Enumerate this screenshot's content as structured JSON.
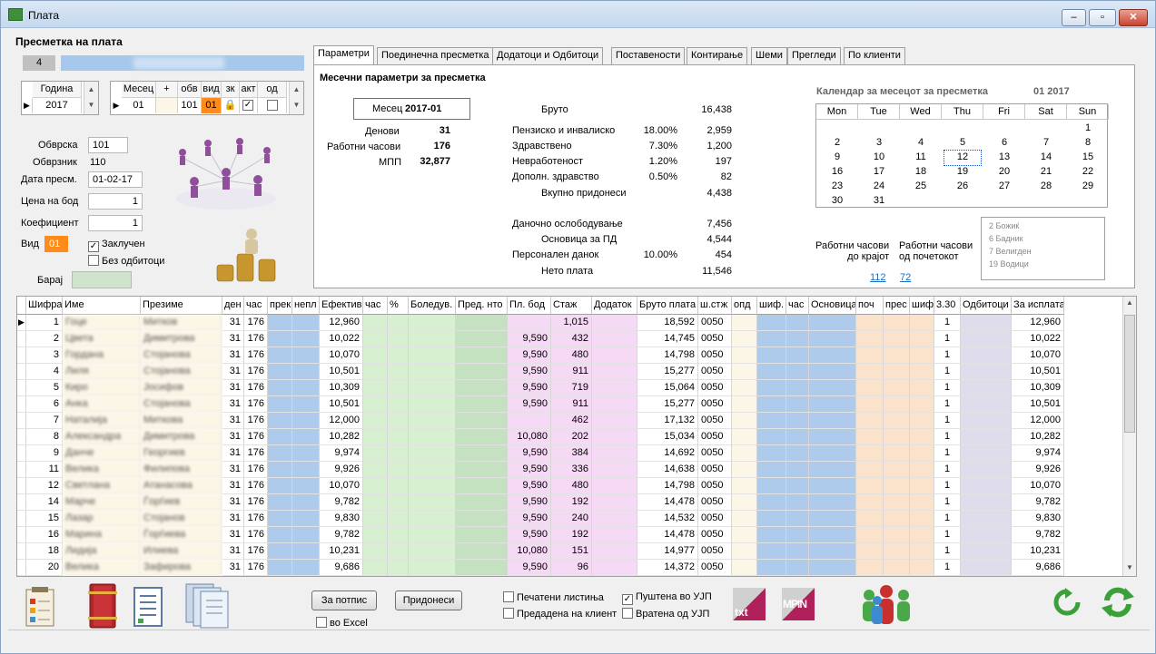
{
  "window": {
    "title": "Плата"
  },
  "left": {
    "heading": "Пресметка на плата",
    "progress_value": "4",
    "year_grid": {
      "header": "Година",
      "value": "2017"
    },
    "month_grid": {
      "headers": [
        "Месец",
        "+",
        "обв",
        "вид",
        "зк",
        "акт",
        "од"
      ],
      "values": [
        "01",
        "",
        "101",
        "01",
        "",
        "",
        ""
      ]
    },
    "obvrska_label": "Обврска",
    "obvrska_value": "101",
    "obvrznik_label": "Обврзник",
    "obvrznik_value": "110",
    "datum_label": "Дата пресм.",
    "datum_value": "01-02-17",
    "cena_label": "Цена на бод",
    "cena_value": "1",
    "koef_label": "Коефициент",
    "koef_value": "1",
    "vid_label": "Вид",
    "vid_value": "01",
    "zaklucen_label": "Заклучен",
    "zaklucen_checked": true,
    "bez_odbitoci_label": "Без одбитоци",
    "bez_odbitoci_checked": false,
    "baraj_label": "Барај"
  },
  "tabs": [
    "Параметри",
    "Поединечна пресметка",
    "Додатоци и Одбитоци",
    "Поставености",
    "Контирање",
    "Шеми",
    "Прегледи",
    "По клиенти"
  ],
  "params": {
    "heading": "Месечни параметри за пресметка",
    "mesec_label": "Месец",
    "mesec_value": "2017-01",
    "denovi_label": "Денови",
    "denovi_value": "31",
    "rab_casovi_label": "Работни часови",
    "rab_casovi_value": "176",
    "mpp_label": "МПП",
    "mpp_value": "32,877",
    "bruto_label": "Бруто",
    "bruto_value": "16,438",
    "rows": [
      {
        "label": "Пензиско и инвалиско",
        "pct": "18.00%",
        "value": "2,959"
      },
      {
        "label": "Здравствено",
        "pct": "7.30%",
        "value": "1,200"
      },
      {
        "label": "Невработеност",
        "pct": "1.20%",
        "value": "197"
      },
      {
        "label": "Дополн. здравство",
        "pct": "0.50%",
        "value": "82"
      }
    ],
    "vkupno_label": "Вкупно придонеси",
    "vkupno_value": "4,438",
    "danocno_label": "Даночно ослободување",
    "danocno_value": "7,456",
    "osnovica_label": "Основица за ПД",
    "osnovica_value": "4,544",
    "personalen_label": "Персонален данок",
    "personalen_pct": "10.00%",
    "personalen_value": "454",
    "neto_label": "Нето плата",
    "neto_value": "11,546"
  },
  "calendar": {
    "title": "Календар за месецот за пресметка",
    "month_year": "01  2017",
    "days": [
      "Mon",
      "Tue",
      "Wed",
      "Thu",
      "Fri",
      "Sat",
      "Sun"
    ],
    "weeks": [
      [
        "",
        "",
        "",
        "",
        "",
        "",
        "1"
      ],
      [
        "2",
        "3",
        "4",
        "5",
        "6",
        "7",
        "8"
      ],
      [
        "9",
        "10",
        "11",
        "12",
        "13",
        "14",
        "15"
      ],
      [
        "16",
        "17",
        "18",
        "19",
        "20",
        "21",
        "22"
      ],
      [
        "23",
        "24",
        "25",
        "26",
        "27",
        "28",
        "29"
      ],
      [
        "30",
        "31",
        "",
        "",
        "",
        "",
        ""
      ]
    ],
    "today": "12",
    "rab_do_kraj_label1": "Работни часови",
    "rab_do_kraj_label2": "до крајот",
    "rab_do_kraj_value": "112",
    "rab_od_poc_label1": "Работни часови",
    "rab_od_poc_label2": "од почетокот",
    "rab_od_poc_value": "72",
    "holidays": [
      "2   Божиќ",
      "6   Бадник",
      "7   Велигден",
      "19  Водици"
    ]
  },
  "grid": {
    "headers": [
      "Шифра",
      "Име",
      "Презиме",
      "ден",
      "час",
      "прек",
      "непл",
      "Ефектив",
      "час",
      "%",
      "Боледув.",
      "Пред. нто",
      "Пл. бод",
      "Стаж",
      "Додаток",
      "Бруто плата",
      "ш.стж",
      "опд",
      "шиф.",
      "час",
      "Основица",
      "поч",
      "прес",
      "шиф",
      "3.30",
      "Одбитоци",
      "За исплата"
    ],
    "rows": [
      {
        "sifra": "1",
        "ime": "Гоце",
        "prezime": "Митков",
        "den": "31",
        "cas": "176",
        "efektiv": "12,960",
        "plbod": "",
        "staz": "1,015",
        "bruto": "18,592",
        "sstz": "0050",
        "n330": "1",
        "zaisplata": "12,960"
      },
      {
        "sifra": "2",
        "ime": "Цвета",
        "prezime": "Димитрова",
        "den": "31",
        "cas": "176",
        "efektiv": "10,022",
        "plbod": "9,590",
        "staz": "432",
        "bruto": "14,745",
        "sstz": "0050",
        "n330": "1",
        "zaisplata": "10,022"
      },
      {
        "sifra": "3",
        "ime": "Гордана",
        "prezime": "Стојанова",
        "den": "31",
        "cas": "176",
        "efektiv": "10,070",
        "plbod": "9,590",
        "staz": "480",
        "bruto": "14,798",
        "sstz": "0050",
        "n330": "1",
        "zaisplata": "10,070"
      },
      {
        "sifra": "4",
        "ime": "Лиля",
        "prezime": "Стојанова",
        "den": "31",
        "cas": "176",
        "efektiv": "10,501",
        "plbod": "9,590",
        "staz": "911",
        "bruto": "15,277",
        "sstz": "0050",
        "n330": "1",
        "zaisplata": "10,501"
      },
      {
        "sifra": "5",
        "ime": "Киро",
        "prezime": "Јосифов",
        "den": "31",
        "cas": "176",
        "efektiv": "10,309",
        "plbod": "9,590",
        "staz": "719",
        "bruto": "15,064",
        "sstz": "0050",
        "n330": "1",
        "zaisplata": "10,309"
      },
      {
        "sifra": "6",
        "ime": "Анка",
        "prezime": "Стојанова",
        "den": "31",
        "cas": "176",
        "efektiv": "10,501",
        "plbod": "9,590",
        "staz": "911",
        "bruto": "15,277",
        "sstz": "0050",
        "n330": "1",
        "zaisplata": "10,501"
      },
      {
        "sifra": "7",
        "ime": "Наталија",
        "prezime": "Миткова",
        "den": "31",
        "cas": "176",
        "efektiv": "12,000",
        "plbod": "",
        "staz": "462",
        "bruto": "17,132",
        "sstz": "0050",
        "n330": "1",
        "zaisplata": "12,000"
      },
      {
        "sifra": "8",
        "ime": "Александра",
        "prezime": "Димитрова",
        "den": "31",
        "cas": "176",
        "efektiv": "10,282",
        "plbod": "10,080",
        "staz": "202",
        "bruto": "15,034",
        "sstz": "0050",
        "n330": "1",
        "zaisplata": "10,282"
      },
      {
        "sifra": "9",
        "ime": "Данче",
        "prezime": "Георгиев",
        "den": "31",
        "cas": "176",
        "efektiv": "9,974",
        "plbod": "9,590",
        "staz": "384",
        "bruto": "14,692",
        "sstz": "0050",
        "n330": "1",
        "zaisplata": "9,974"
      },
      {
        "sifra": "11",
        "ime": "Велика",
        "prezime": "Филипова",
        "den": "31",
        "cas": "176",
        "efektiv": "9,926",
        "plbod": "9,590",
        "staz": "336",
        "bruto": "14,638",
        "sstz": "0050",
        "n330": "1",
        "zaisplata": "9,926"
      },
      {
        "sifra": "12",
        "ime": "Светлана",
        "prezime": "Атанасова",
        "den": "31",
        "cas": "176",
        "efektiv": "10,070",
        "plbod": "9,590",
        "staz": "480",
        "bruto": "14,798",
        "sstz": "0050",
        "n330": "1",
        "zaisplata": "10,070"
      },
      {
        "sifra": "14",
        "ime": "Марче",
        "prezime": "Ѓорѓиев",
        "den": "31",
        "cas": "176",
        "efektiv": "9,782",
        "plbod": "9,590",
        "staz": "192",
        "bruto": "14,478",
        "sstz": "0050",
        "n330": "1",
        "zaisplata": "9,782"
      },
      {
        "sifra": "15",
        "ime": "Лазар",
        "prezime": "Стојанов",
        "den": "31",
        "cas": "176",
        "efektiv": "9,830",
        "plbod": "9,590",
        "staz": "240",
        "bruto": "14,532",
        "sstz": "0050",
        "n330": "1",
        "zaisplata": "9,830"
      },
      {
        "sifra": "16",
        "ime": "Марина",
        "prezime": "Ѓорѓиева",
        "den": "31",
        "cas": "176",
        "efektiv": "9,782",
        "plbod": "9,590",
        "staz": "192",
        "bruto": "14,478",
        "sstz": "0050",
        "n330": "1",
        "zaisplata": "9,782"
      },
      {
        "sifra": "18",
        "ime": "Лидија",
        "prezime": "Илиева",
        "den": "31",
        "cas": "176",
        "efektiv": "10,231",
        "plbod": "10,080",
        "staz": "151",
        "bruto": "14,977",
        "sstz": "0050",
        "n330": "1",
        "zaisplata": "10,231"
      },
      {
        "sifra": "20",
        "ime": "Велика",
        "prezime": "Зафирова",
        "den": "31",
        "cas": "176",
        "efektiv": "9,686",
        "plbod": "9,590",
        "staz": "96",
        "bruto": "14,372",
        "sstz": "0050",
        "n330": "1",
        "zaisplata": "9,686"
      }
    ]
  },
  "bottom": {
    "za_potpis": "За потпис",
    "pridonesi": "Придонеси",
    "vo_excel": "во Excel",
    "pecateni": "Печатени листиња",
    "predadena": "Предадена на клиент",
    "pustena": "Пуштена во УЈП",
    "vratena": "Вратена од УЈП",
    "txt_label": "txt",
    "mpin_label": "MPIN"
  },
  "colors": {
    "blue_col": "#aecbec",
    "green_col": "#d7f0cf",
    "green_dark": "#c5e2c0",
    "pink_col": "#f6d9f4",
    "peach_col": "#fbe2cb",
    "lav_col": "#dfdcec",
    "cream_col": "#fcf6e6",
    "orange_vid": "#ff8c1a"
  }
}
